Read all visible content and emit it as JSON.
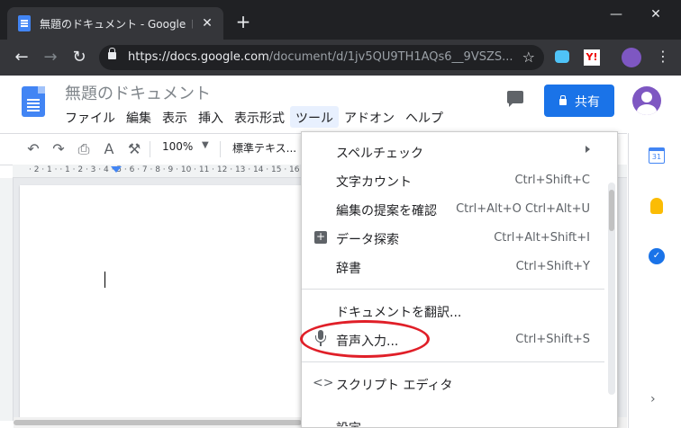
{
  "browser": {
    "tab_title": "無題のドキュメント - Google ドキュメン",
    "tab_close": "✕",
    "new_tab": "+",
    "url_host": "https://docs.google.com",
    "url_path": "/document/d/1jv5QU9TH1AQs6__9VSZS...",
    "window_buttons": {
      "minimize": "—",
      "maximize": "☐",
      "close": "✕"
    },
    "ext_badge": "Y!"
  },
  "docs": {
    "title": "無題のドキュメント",
    "menubar": [
      "ファイル",
      "編集",
      "表示",
      "挿入",
      "表示形式",
      "ツール",
      "アドオン",
      "ヘルプ"
    ],
    "share_label": "共有"
  },
  "toolbar": {
    "zoom": "100%",
    "style": "標準テキス..."
  },
  "ruler": {
    "marks": "· 2 · 1 ·   · 1 · 2 · 3 · 4 · 5 · 6 · 7 · 8 · 9 · 10 · 11 · 12 · 13 · 14 · 15 · 16"
  },
  "sidepanel": {
    "calendar_day": "31",
    "tasks_glyph": "✓"
  },
  "tools_menu": {
    "items": [
      {
        "label": "スペルチェック",
        "shortcut": "",
        "submenu": true
      },
      {
        "label": "文字カウント",
        "shortcut": "Ctrl+Shift+C"
      },
      {
        "label": "編集の提案を確認",
        "shortcut": "Ctrl+Alt+O Ctrl+Alt+U"
      },
      {
        "label": "データ探索",
        "shortcut": "Ctrl+Alt+Shift+I",
        "icon": "explore-icon"
      },
      {
        "label": "辞書",
        "shortcut": "Ctrl+Shift+Y"
      },
      {
        "label": "ドキュメントを翻訳...",
        "shortcut": ""
      },
      {
        "label": "音声入力...",
        "shortcut": "Ctrl+Shift+S",
        "icon": "microphone-icon"
      },
      {
        "label": "スクリプト エディタ",
        "shortcut": "",
        "icon": "code-icon"
      },
      {
        "label": "設定",
        "shortcut": ""
      }
    ],
    "code_glyph": "<>",
    "plus_glyph": "+"
  },
  "colors": {
    "accent": "#1a73e8",
    "highlight": "#e01f28",
    "chrome_dark": "#202124"
  }
}
